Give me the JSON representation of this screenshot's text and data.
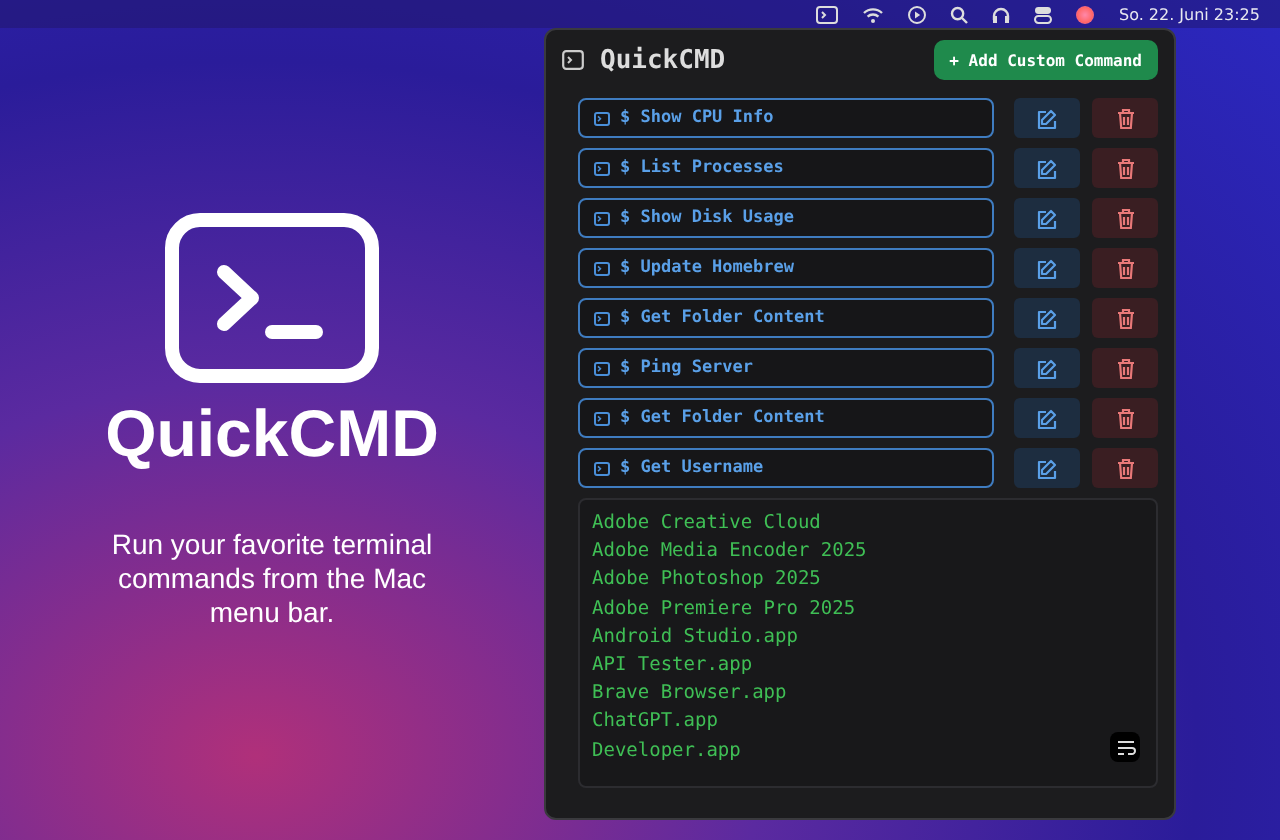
{
  "menu_bar": {
    "clock": "So. 22. Juni  23:25"
  },
  "promo": {
    "title": "QuickCMD",
    "tagline": "Run your favorite terminal commands from the Mac menu bar."
  },
  "panel": {
    "title": "QuickCMD",
    "add_button": "+ Add Custom Command",
    "commands": [
      {
        "label": "$ Show CPU Info"
      },
      {
        "label": "$ List Processes"
      },
      {
        "label": "$ Show Disk Usage"
      },
      {
        "label": "$ Update Homebrew"
      },
      {
        "label": "$ Get Folder Content"
      },
      {
        "label": "$ Ping Server"
      },
      {
        "label": "$ Get Folder Content"
      },
      {
        "label": "$ Get Username"
      }
    ],
    "output": [
      "Adobe Creative Cloud",
      "Adobe Media Encoder 2025",
      "Adobe Photoshop 2025",
      "Adobe Premiere Pro 2025",
      "Android Studio.app",
      "API Tester.app",
      "Brave Browser.app",
      "ChatGPT.app",
      "Developer.app"
    ]
  }
}
